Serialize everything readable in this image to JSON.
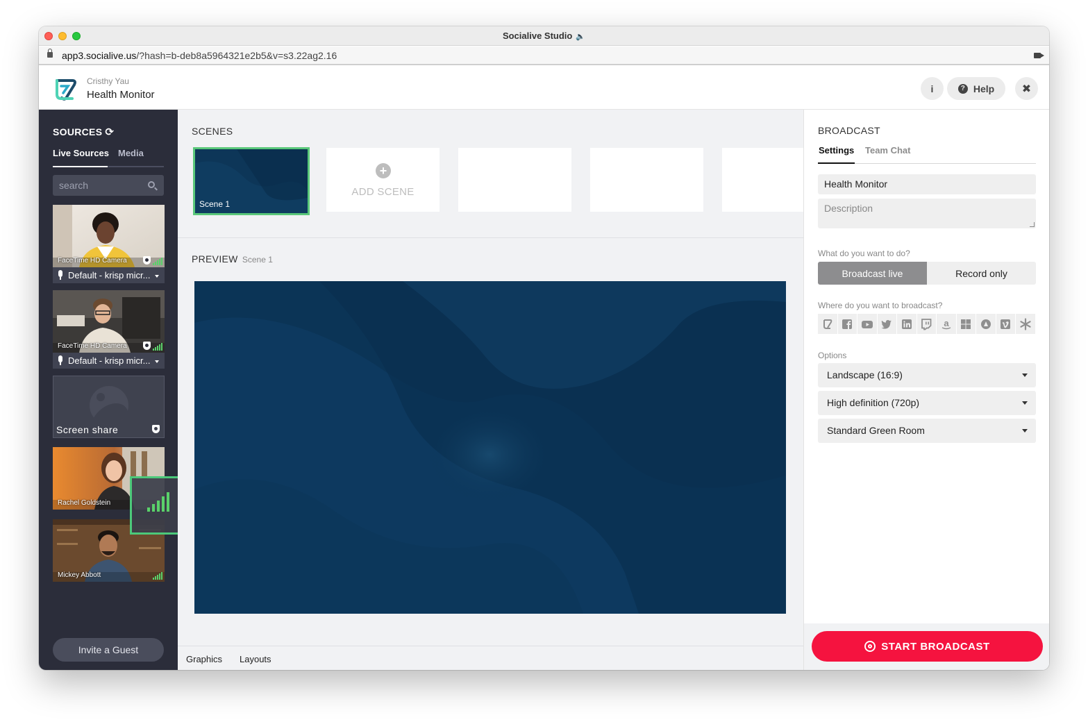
{
  "window": {
    "title": "Socialive Studio",
    "url_host": "app3.socialive.us",
    "url_path": "/?hash=b-deb8a5964321e2b5&v=s3.22ag2.16"
  },
  "header": {
    "user_name": "Cristhy Yau",
    "event_title": "Health Monitor",
    "info_label": "i",
    "help_label": "Help",
    "close_label": "✖"
  },
  "sidebar": {
    "title": "SOURCES",
    "tabs": [
      "Live Sources",
      "Media"
    ],
    "search_placeholder": "search",
    "sources": [
      {
        "label": "FaceTime HD Camera",
        "mic": "Default - krisp micr..."
      },
      {
        "label": "FaceTime HD Camera",
        "mic": "Default - krisp micr..."
      },
      {
        "label": "Screen share"
      },
      {
        "label": "Rachel Goldstein"
      },
      {
        "label": "Mickey Abbott"
      }
    ],
    "invite_label": "Invite a Guest"
  },
  "scenes": {
    "title": "SCENES",
    "items": [
      "Scene 1"
    ],
    "add_label": "ADD SCENE"
  },
  "preview": {
    "title": "PREVIEW",
    "scene_name": "Scene 1"
  },
  "bottom_tabs": [
    "Graphics",
    "Layouts"
  ],
  "broadcast": {
    "title": "BROADCAST",
    "tabs": [
      "Settings",
      "Team Chat"
    ],
    "title_value": "Health Monitor",
    "description_placeholder": "Description",
    "question_do": "What do you want to do?",
    "mode_options": [
      "Broadcast live",
      "Record only"
    ],
    "selected_mode": "Broadcast live",
    "question_where": "Where do you want to broadcast?",
    "destinations": [
      "socialive-icon",
      "facebook-icon",
      "youtube-icon",
      "twitter-icon",
      "linkedin-icon",
      "twitch-icon",
      "amazon-icon",
      "microsoft-icon",
      "google-drive-icon",
      "vimeo-icon",
      "custom-rtmp-icon"
    ],
    "options_label": "Options",
    "orientation": "Landscape (16:9)",
    "quality": "High definition (720p)",
    "green_room": "Standard Green Room",
    "start_label": "START BROADCAST",
    "accent_color": "#f5133f"
  }
}
